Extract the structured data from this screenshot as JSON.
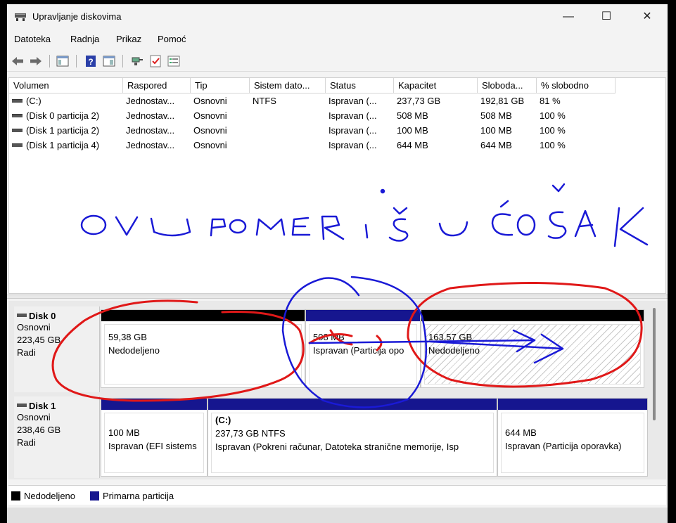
{
  "window": {
    "title": "Upravljanje diskovima"
  },
  "menu": [
    "Datoteka",
    "Radnja",
    "Prikaz",
    "Pomoć"
  ],
  "toolbar_icons": [
    "back-arrow-icon",
    "forward-arrow-icon",
    "console-tree-icon",
    "help-icon",
    "show-hide-icon",
    "connect-icon",
    "properties-check-icon",
    "list-icon"
  ],
  "volume_table": {
    "columns": [
      "Volumen",
      "Raspored",
      "Tip",
      "Sistem dato...",
      "Status",
      "Kapacitet",
      "Sloboda...",
      "% slobodno"
    ],
    "rows": [
      [
        "(C:)",
        "Jednostav...",
        "Osnovni",
        "NTFS",
        "Ispravan (...",
        "237,73 GB",
        "192,81 GB",
        "81 %"
      ],
      [
        "(Disk 0 particija 2)",
        "Jednostav...",
        "Osnovni",
        "",
        "Ispravan (...",
        "508 MB",
        "508 MB",
        "100 %"
      ],
      [
        "(Disk 1 particija 2)",
        "Jednostav...",
        "Osnovni",
        "",
        "Ispravan (...",
        "100 MB",
        "100 MB",
        "100 %"
      ],
      [
        "(Disk 1 particija 4)",
        "Jednostav...",
        "Osnovni",
        "",
        "Ispravan (...",
        "644 MB",
        "644 MB",
        "100 %"
      ]
    ]
  },
  "disks": [
    {
      "name": "Disk 0",
      "type": "Osnovni",
      "size": "223,45 GB",
      "state": "Radi",
      "partitions": [
        {
          "label": "",
          "size": "59,38 GB",
          "status": "Nedodeljeno"
        },
        {
          "label": "",
          "size": "508 MB",
          "status": "Ispravan (Particija opo"
        },
        {
          "label": "",
          "size": "163,57 GB",
          "status": "Nedodeljeno"
        }
      ]
    },
    {
      "name": "Disk 1",
      "type": "Osnovni",
      "size": "238,46 GB",
      "state": "Radi",
      "partitions": [
        {
          "label": "",
          "size": "100 MB",
          "status": "Ispravan (EFI sistems"
        },
        {
          "label": "(C:)",
          "size": "237,73 GB NTFS",
          "status": "Ispravan (Pokreni računar, Datoteka stranične memorije, Isp"
        },
        {
          "label": "",
          "size": "644 MB",
          "status": "Ispravan (Particija oporavka)"
        }
      ]
    }
  ],
  "legend": [
    {
      "label": "Nedodeljeno",
      "color": "#000000"
    },
    {
      "label": "Primarna particija",
      "color": "#16168f"
    }
  ],
  "annotation_text": "OVU POMERIŠ U ĆOŠAK",
  "colors": {
    "primary_bar": "#16168f",
    "unallocated_bar": "#000000",
    "ink_blue": "#1a1ad6",
    "ink_red": "#e01818"
  }
}
